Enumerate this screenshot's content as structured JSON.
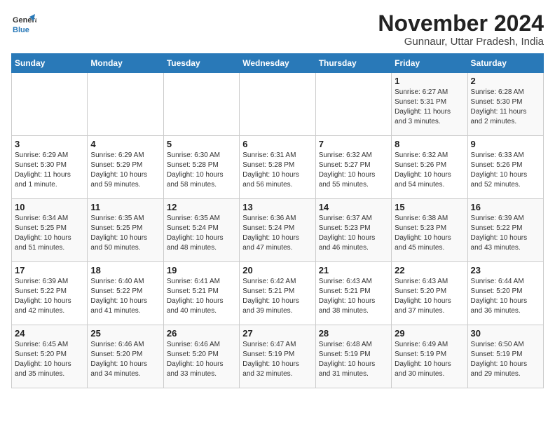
{
  "logo": {
    "line1": "General",
    "line2": "Blue"
  },
  "title": "November 2024",
  "subtitle": "Gunnaur, Uttar Pradesh, India",
  "headers": [
    "Sunday",
    "Monday",
    "Tuesday",
    "Wednesday",
    "Thursday",
    "Friday",
    "Saturday"
  ],
  "weeks": [
    [
      {
        "day": "",
        "info": ""
      },
      {
        "day": "",
        "info": ""
      },
      {
        "day": "",
        "info": ""
      },
      {
        "day": "",
        "info": ""
      },
      {
        "day": "",
        "info": ""
      },
      {
        "day": "1",
        "info": "Sunrise: 6:27 AM\nSunset: 5:31 PM\nDaylight: 11 hours\nand 3 minutes."
      },
      {
        "day": "2",
        "info": "Sunrise: 6:28 AM\nSunset: 5:30 PM\nDaylight: 11 hours\nand 2 minutes."
      }
    ],
    [
      {
        "day": "3",
        "info": "Sunrise: 6:29 AM\nSunset: 5:30 PM\nDaylight: 11 hours\nand 1 minute."
      },
      {
        "day": "4",
        "info": "Sunrise: 6:29 AM\nSunset: 5:29 PM\nDaylight: 10 hours\nand 59 minutes."
      },
      {
        "day": "5",
        "info": "Sunrise: 6:30 AM\nSunset: 5:28 PM\nDaylight: 10 hours\nand 58 minutes."
      },
      {
        "day": "6",
        "info": "Sunrise: 6:31 AM\nSunset: 5:28 PM\nDaylight: 10 hours\nand 56 minutes."
      },
      {
        "day": "7",
        "info": "Sunrise: 6:32 AM\nSunset: 5:27 PM\nDaylight: 10 hours\nand 55 minutes."
      },
      {
        "day": "8",
        "info": "Sunrise: 6:32 AM\nSunset: 5:26 PM\nDaylight: 10 hours\nand 54 minutes."
      },
      {
        "day": "9",
        "info": "Sunrise: 6:33 AM\nSunset: 5:26 PM\nDaylight: 10 hours\nand 52 minutes."
      }
    ],
    [
      {
        "day": "10",
        "info": "Sunrise: 6:34 AM\nSunset: 5:25 PM\nDaylight: 10 hours\nand 51 minutes."
      },
      {
        "day": "11",
        "info": "Sunrise: 6:35 AM\nSunset: 5:25 PM\nDaylight: 10 hours\nand 50 minutes."
      },
      {
        "day": "12",
        "info": "Sunrise: 6:35 AM\nSunset: 5:24 PM\nDaylight: 10 hours\nand 48 minutes."
      },
      {
        "day": "13",
        "info": "Sunrise: 6:36 AM\nSunset: 5:24 PM\nDaylight: 10 hours\nand 47 minutes."
      },
      {
        "day": "14",
        "info": "Sunrise: 6:37 AM\nSunset: 5:23 PM\nDaylight: 10 hours\nand 46 minutes."
      },
      {
        "day": "15",
        "info": "Sunrise: 6:38 AM\nSunset: 5:23 PM\nDaylight: 10 hours\nand 45 minutes."
      },
      {
        "day": "16",
        "info": "Sunrise: 6:39 AM\nSunset: 5:22 PM\nDaylight: 10 hours\nand 43 minutes."
      }
    ],
    [
      {
        "day": "17",
        "info": "Sunrise: 6:39 AM\nSunset: 5:22 PM\nDaylight: 10 hours\nand 42 minutes."
      },
      {
        "day": "18",
        "info": "Sunrise: 6:40 AM\nSunset: 5:22 PM\nDaylight: 10 hours\nand 41 minutes."
      },
      {
        "day": "19",
        "info": "Sunrise: 6:41 AM\nSunset: 5:21 PM\nDaylight: 10 hours\nand 40 minutes."
      },
      {
        "day": "20",
        "info": "Sunrise: 6:42 AM\nSunset: 5:21 PM\nDaylight: 10 hours\nand 39 minutes."
      },
      {
        "day": "21",
        "info": "Sunrise: 6:43 AM\nSunset: 5:21 PM\nDaylight: 10 hours\nand 38 minutes."
      },
      {
        "day": "22",
        "info": "Sunrise: 6:43 AM\nSunset: 5:20 PM\nDaylight: 10 hours\nand 37 minutes."
      },
      {
        "day": "23",
        "info": "Sunrise: 6:44 AM\nSunset: 5:20 PM\nDaylight: 10 hours\nand 36 minutes."
      }
    ],
    [
      {
        "day": "24",
        "info": "Sunrise: 6:45 AM\nSunset: 5:20 PM\nDaylight: 10 hours\nand 35 minutes."
      },
      {
        "day": "25",
        "info": "Sunrise: 6:46 AM\nSunset: 5:20 PM\nDaylight: 10 hours\nand 34 minutes."
      },
      {
        "day": "26",
        "info": "Sunrise: 6:46 AM\nSunset: 5:20 PM\nDaylight: 10 hours\nand 33 minutes."
      },
      {
        "day": "27",
        "info": "Sunrise: 6:47 AM\nSunset: 5:19 PM\nDaylight: 10 hours\nand 32 minutes."
      },
      {
        "day": "28",
        "info": "Sunrise: 6:48 AM\nSunset: 5:19 PM\nDaylight: 10 hours\nand 31 minutes."
      },
      {
        "day": "29",
        "info": "Sunrise: 6:49 AM\nSunset: 5:19 PM\nDaylight: 10 hours\nand 30 minutes."
      },
      {
        "day": "30",
        "info": "Sunrise: 6:50 AM\nSunset: 5:19 PM\nDaylight: 10 hours\nand 29 minutes."
      }
    ]
  ]
}
